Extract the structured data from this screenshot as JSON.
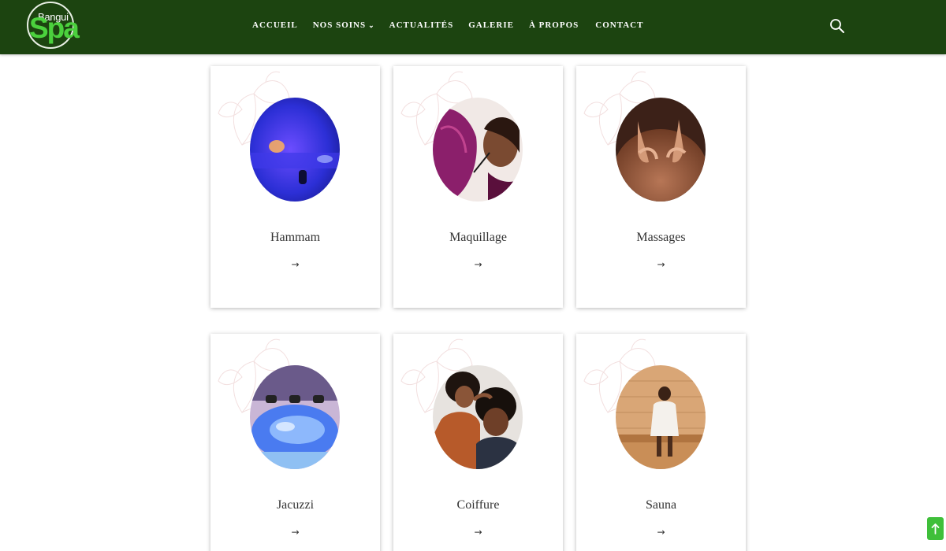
{
  "header": {
    "logo": {
      "top_text": "Bangui",
      "main_text": "Spa"
    },
    "nav": [
      {
        "label": "ACCUEIL"
      },
      {
        "label": "NOS SOINS",
        "has_dropdown": true
      },
      {
        "label": "ACTUALITÉS"
      },
      {
        "label": "GALERIE"
      },
      {
        "label": "À PROPOS"
      },
      {
        "label": "CONTACT"
      }
    ],
    "search_icon": "search-icon"
  },
  "services": [
    {
      "title": "Hammam",
      "arrow": "→"
    },
    {
      "title": "Maquillage",
      "arrow": "→"
    },
    {
      "title": "Massages",
      "arrow": "→"
    },
    {
      "title": "Jacuzzi",
      "arrow": "→"
    },
    {
      "title": "Coiffure",
      "arrow": "→"
    },
    {
      "title": "Sauna",
      "arrow": "→"
    }
  ],
  "scroll_top_icon": "arrow-up-icon",
  "colors": {
    "header_bg": "#1c4410",
    "logo_green": "#4bd13d",
    "scroll_button": "#3fbf3a"
  }
}
